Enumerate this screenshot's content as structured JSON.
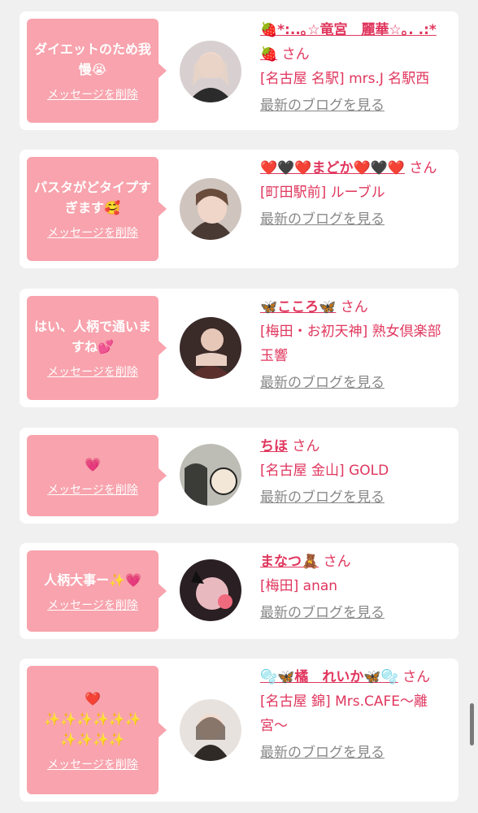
{
  "items": [
    {
      "message": "ダイエットのため我慢😭",
      "delete_label": "メッセージを削除",
      "name": "🍓*:..｡☆竜宮　麗華☆｡.  .:*🍓",
      "suffix": "さん",
      "shop": "[名古屋 名駅] mrs.J 名駅西",
      "blog_label": "最新のブログを見る"
    },
    {
      "message": "パスタがどタイプすぎます🥰",
      "delete_label": "メッセージを削除",
      "name": "❤️🖤❤️まどか❤️🖤❤️",
      "suffix": "さん",
      "shop": "[町田駅前] ルーブル",
      "blog_label": "最新のブログを見る"
    },
    {
      "message": "はい、人柄で通いますね💕",
      "delete_label": "メッセージを削除",
      "name": "🦋こころ🦋",
      "suffix": "さん",
      "shop": "[梅田・お初天神] 熟女倶楽部 玉響",
      "blog_label": "最新のブログを見る"
    },
    {
      "message": "💗",
      "delete_label": "メッセージを削除",
      "name": "ちほ",
      "suffix": "さん",
      "shop": "[名古屋 金山] GOLD",
      "blog_label": "最新のブログを見る"
    },
    {
      "message": "人柄大事ー✨💗",
      "delete_label": "メッセージを削除",
      "name": "まなつ🧸",
      "suffix": "さん",
      "shop": "[梅田] anan",
      "blog_label": "最新のブログを見る"
    },
    {
      "message": "❤️\n✨✨✨✨✨✨\n✨✨✨✨",
      "delete_label": "メッセージを削除",
      "name": "🫧🦋橘　れいか🦋🫧",
      "suffix": "さん",
      "shop": "[名古屋 錦] Mrs.CAFE〜離宮〜",
      "blog_label": "最新のブログを見る"
    }
  ],
  "colors": {
    "accent": "#e0365d",
    "bubble": "#f8a3ad",
    "background": "#f0f0f0",
    "link_gray": "#888888"
  },
  "icons": {
    "avatar": "profile-photo"
  }
}
